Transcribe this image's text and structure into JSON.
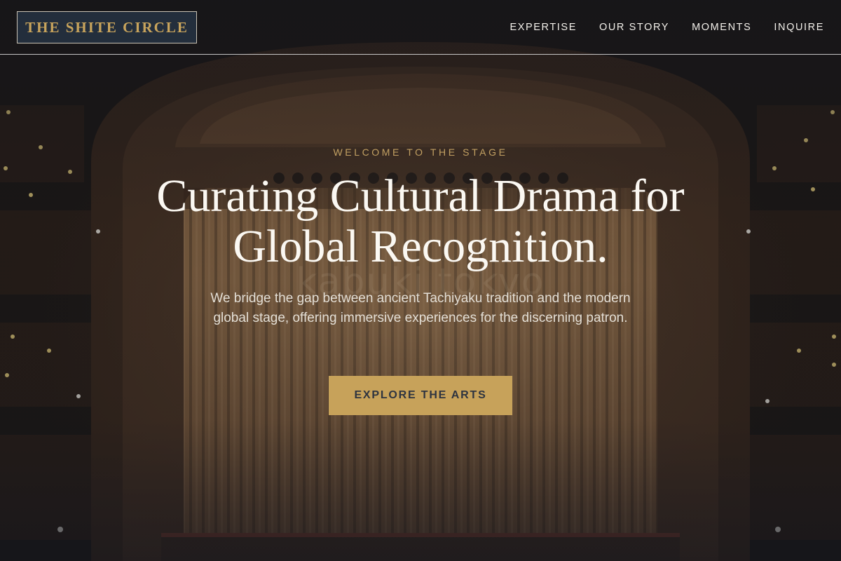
{
  "brand": {
    "name": "THE SHITE CIRCLE"
  },
  "nav": {
    "items": [
      {
        "label": "EXPERTISE"
      },
      {
        "label": "OUR STORY"
      },
      {
        "label": "MOMENTS"
      },
      {
        "label": "INQUIRE"
      }
    ]
  },
  "hero": {
    "eyebrow": "WELCOME TO THE STAGE",
    "headline_line1": "Curating Cultural Drama for",
    "headline_line2": "Global Recognition.",
    "lede": "We bridge the gap between ancient Tachiyaku tradition and the modern global stage, offering immersive experiences for the discerning patron.",
    "cta_label": "EXPLORE THE ARTS",
    "watermark": "kabuki tokyo"
  },
  "colors": {
    "accent_gold": "#c7a25a",
    "logo_bg": "#28374b",
    "dark_text": "#2e3440",
    "light_text": "#fbf8f2"
  },
  "icons": {
    "logo": "text-wordmark"
  }
}
